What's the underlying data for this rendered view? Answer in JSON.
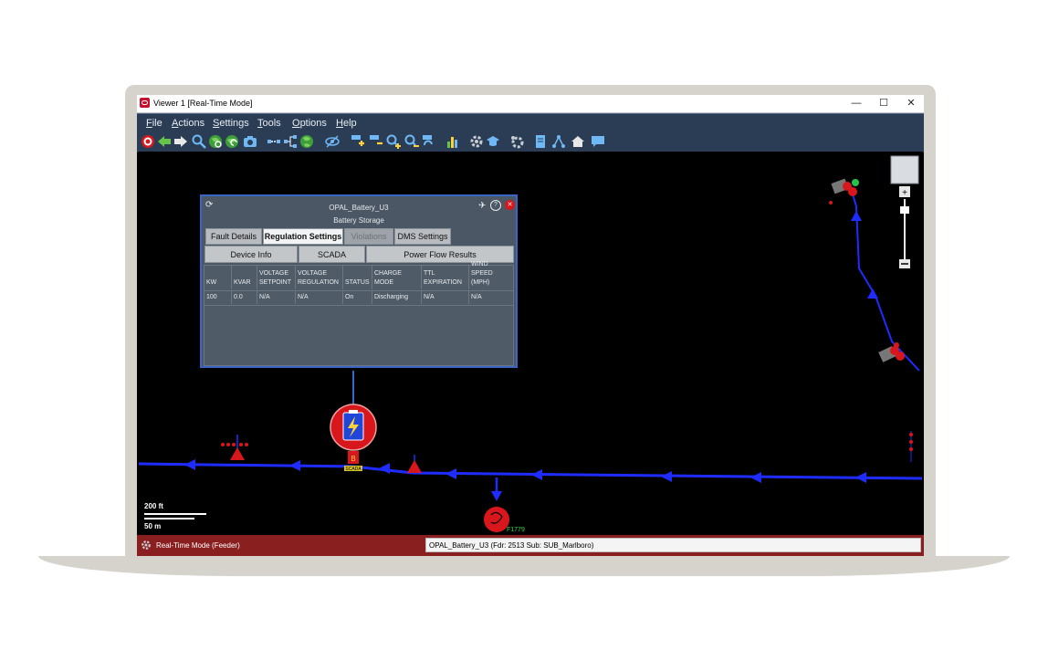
{
  "window": {
    "title": "Viewer 1 [Real-Time Mode]",
    "controls": {
      "minimize": "—",
      "maximize": "☐",
      "close": "✕"
    }
  },
  "menu": {
    "items": [
      {
        "first": "F",
        "rest": "ile"
      },
      {
        "first": "A",
        "rest": "ctions"
      },
      {
        "first": "S",
        "rest": "ettings"
      },
      {
        "first": "T",
        "rest": "ools"
      },
      {
        "first": "O",
        "rest": "ptions"
      },
      {
        "first": "H",
        "rest": "elp"
      }
    ]
  },
  "toolbar": {
    "icons": [
      "target-icon",
      "back-arrow-icon",
      "forward-arrow-icon",
      "zoom-icon",
      "globe-zoom-icon",
      "globe-refresh-icon",
      "camera-icon",
      "connect-icon",
      "tree-icon",
      "globe-icon",
      "hide-icon",
      "abc-plus-icon",
      "abc-minus-icon",
      "zoom-in-icon",
      "zoom-out-icon",
      "abc-refresh-icon",
      "chart-icon",
      "gear-icon",
      "graduation-icon",
      "settings-icon",
      "document-icon",
      "network-icon",
      "home-icon",
      "comment-icon"
    ],
    "colors": {
      "primary": "#6fb8f5",
      "accent": "#ffffff",
      "green": "#66c44a"
    }
  },
  "panel": {
    "title": "OPAL_Battery_U3",
    "subtitle": "Battery Storage",
    "tabs": [
      {
        "label": "Fault Details",
        "state": "normal"
      },
      {
        "label": "Regulation Settings",
        "state": "active"
      },
      {
        "label": "Violations",
        "state": "disabled"
      },
      {
        "label": "DMS Settings",
        "state": "normal"
      }
    ],
    "subtabs": [
      {
        "label": "Device Info"
      },
      {
        "label": "SCADA"
      },
      {
        "label": "Power Flow Results"
      }
    ],
    "columns": [
      "KW",
      "KVAR",
      "VOLTAGE SETPOINT",
      "VOLTAGE REGULATION",
      "STATUS",
      "CHARGE MODE",
      "TTL EXPIRATION",
      "WIND SPEED (MPH)"
    ],
    "rows": [
      [
        "100",
        "0.0",
        "N/A",
        "N/A",
        "On",
        "Discharging",
        "N/A",
        "N/A"
      ]
    ]
  },
  "map": {
    "scale_ft": "200 ft",
    "scale_m": "50 m",
    "label_scada": "SCADA",
    "label_feeder": "F1779",
    "colors": {
      "line": "#1f2cff",
      "device": "#d8171d",
      "background": "#000000"
    }
  },
  "status": {
    "mode": "Real-Time Mode (Feeder)",
    "selection": "OPAL_Battery_U3 (Fdr: 2513 Sub: SUB_Marlboro)"
  }
}
